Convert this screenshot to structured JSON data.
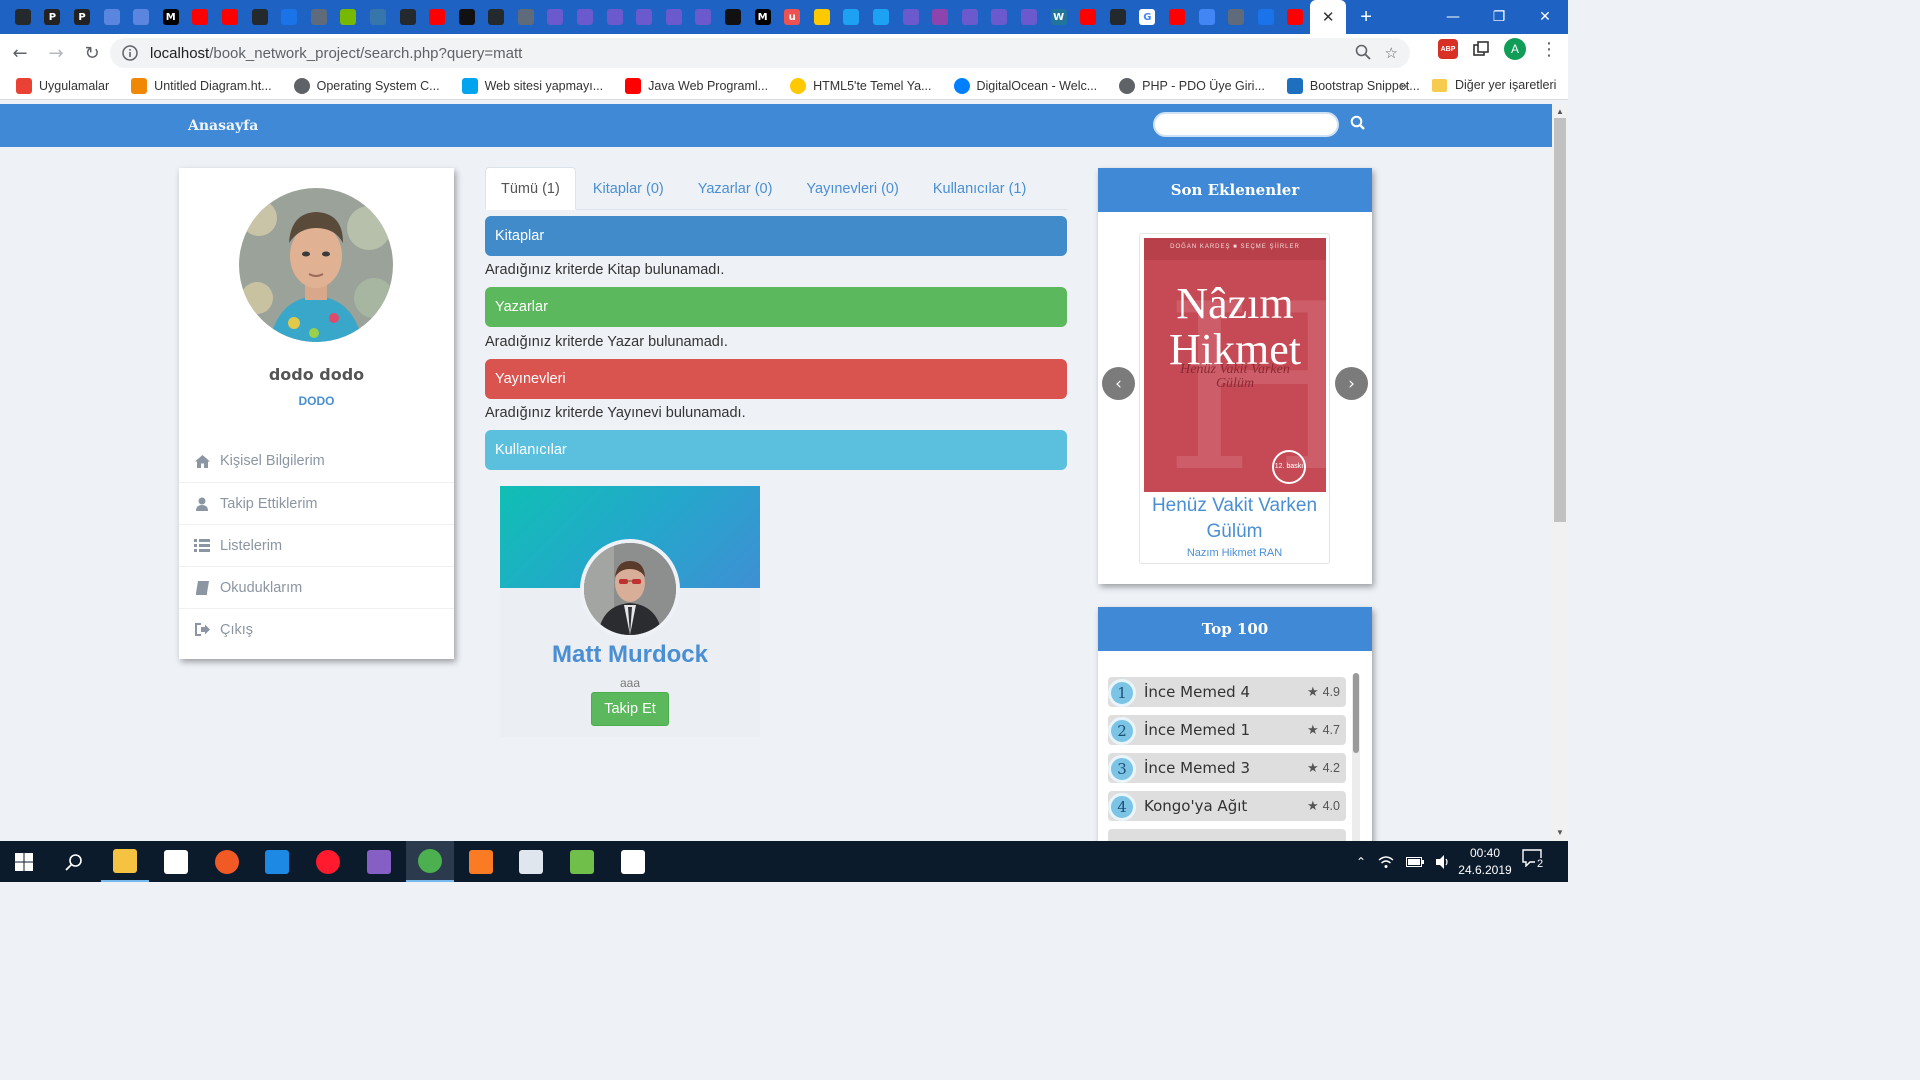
{
  "browser": {
    "tab_favicons": [
      {
        "icon": "github-icon",
        "color": "#24292e",
        "glyph": ""
      },
      {
        "icon": "p-letter-icon",
        "color": "#222222",
        "glyph": "P"
      },
      {
        "icon": "p-letter-icon",
        "color": "#222222",
        "glyph": "P"
      },
      {
        "icon": "arrows-icon",
        "color": "#5b86e0",
        "glyph": ""
      },
      {
        "icon": "arrows-icon",
        "color": "#5b86e0",
        "glyph": ""
      },
      {
        "icon": "medium-icon",
        "color": "#000000",
        "glyph": "M"
      },
      {
        "icon": "youtube-icon",
        "color": "#ff0000",
        "glyph": ""
      },
      {
        "icon": "youtube-icon",
        "color": "#ff0000",
        "glyph": ""
      },
      {
        "icon": "github-icon",
        "color": "#24292e",
        "glyph": ""
      },
      {
        "icon": "target-icon",
        "color": "#1a73e8",
        "glyph": ""
      },
      {
        "icon": "globe-icon",
        "color": "#5f6b7a",
        "glyph": ""
      },
      {
        "icon": "nvidia-icon",
        "color": "#76b900",
        "glyph": ""
      },
      {
        "icon": "python-icon",
        "color": "#3776ab",
        "glyph": ""
      },
      {
        "icon": "github-icon",
        "color": "#24292e",
        "glyph": ""
      },
      {
        "icon": "youtube-icon",
        "color": "#ff0000",
        "glyph": ""
      },
      {
        "icon": "image-icon",
        "color": "#111111",
        "glyph": ""
      },
      {
        "icon": "github-icon",
        "color": "#24292e",
        "glyph": ""
      },
      {
        "icon": "globe-icon",
        "color": "#5f6b7a",
        "glyph": ""
      },
      {
        "icon": "extension-icon",
        "color": "#6a5acd",
        "glyph": ""
      },
      {
        "icon": "extension-icon",
        "color": "#6a5acd",
        "glyph": ""
      },
      {
        "icon": "extension-icon",
        "color": "#6a5acd",
        "glyph": ""
      },
      {
        "icon": "extension-icon",
        "color": "#6a5acd",
        "glyph": ""
      },
      {
        "icon": "extension-icon",
        "color": "#6a5acd",
        "glyph": ""
      },
      {
        "icon": "extension-icon",
        "color": "#6a5acd",
        "glyph": ""
      },
      {
        "icon": "codepen-icon",
        "color": "#111111",
        "glyph": ""
      },
      {
        "icon": "medium-icon",
        "color": "#000000",
        "glyph": "M"
      },
      {
        "icon": "udemy-icon",
        "color": "#ec5252",
        "glyph": "u"
      },
      {
        "icon": "turkcell-icon",
        "color": "#ffc900",
        "glyph": ""
      },
      {
        "icon": "twitter-icon",
        "color": "#1da1f2",
        "glyph": ""
      },
      {
        "icon": "twitter-icon",
        "color": "#1da1f2",
        "glyph": ""
      },
      {
        "icon": "extension-icon",
        "color": "#6a5acd",
        "glyph": ""
      },
      {
        "icon": "atom-icon",
        "color": "#8e44ad",
        "glyph": ""
      },
      {
        "icon": "extension-icon",
        "color": "#6a5acd",
        "glyph": ""
      },
      {
        "icon": "extension-icon",
        "color": "#6a5acd",
        "glyph": ""
      },
      {
        "icon": "extension-icon",
        "color": "#6a5acd",
        "glyph": ""
      },
      {
        "icon": "wordpress-icon",
        "color": "#21759b",
        "glyph": "W"
      },
      {
        "icon": "youtube-icon",
        "color": "#ff0000",
        "glyph": ""
      },
      {
        "icon": "github-icon",
        "color": "#24292e",
        "glyph": ""
      },
      {
        "icon": "google-icon",
        "color": "#ffffff",
        "glyph": "G"
      },
      {
        "icon": "youtube-icon",
        "color": "#ff0000",
        "glyph": ""
      },
      {
        "icon": "translate-icon",
        "color": "#4285f4",
        "glyph": ""
      },
      {
        "icon": "globe-icon",
        "color": "#5f6b7a",
        "glyph": ""
      },
      {
        "icon": "history-icon",
        "color": "#1a73e8",
        "glyph": ""
      },
      {
        "icon": "youtube-icon",
        "color": "#ff0000",
        "glyph": ""
      }
    ],
    "url_host": "localhost",
    "url_path": "/book_network_project/search.php?query=matt",
    "profile_initial": "A",
    "abp_label": "ABP",
    "bookmarks": [
      {
        "label": "Uygulamalar",
        "icon": "apps-grid-icon",
        "color": "#e94235"
      },
      {
        "label": "Untitled Diagram.ht...",
        "icon": "drawio-icon",
        "color": "#f08705"
      },
      {
        "label": "Operating System C...",
        "icon": "globe-icon",
        "color": "#5f6368"
      },
      {
        "label": "Web sitesi yapmayı...",
        "icon": "microsoft-icon",
        "color": "#00a4ef"
      },
      {
        "label": "Java Web Programl...",
        "icon": "youtube-icon",
        "color": "#ff0000"
      },
      {
        "label": "HTML5'te Temel Ya...",
        "icon": "turkcell-icon",
        "color": "#ffc900"
      },
      {
        "label": "DigitalOcean - Welc...",
        "icon": "digitalocean-icon",
        "color": "#0080ff"
      },
      {
        "label": "PHP - PDO Üye Giri...",
        "icon": "globe-icon",
        "color": "#5f6368"
      },
      {
        "label": "Bootstrap Snippet...",
        "icon": "bootstrap-icon",
        "color": "#1f6fbf"
      }
    ],
    "bookmarks_more": "»",
    "other_bookmarks": "Diğer yer işaretleri"
  },
  "site": {
    "brand": "Anasayfa",
    "search_placeholder": "",
    "accent": "#4089d6"
  },
  "profile": {
    "name": "dodo dodo",
    "username": "DODO",
    "menu": [
      {
        "label": "Kişisel Bilgilerim",
        "icon": "home-icon"
      },
      {
        "label": "Takip Ettiklerim",
        "icon": "user-icon"
      },
      {
        "label": "Listelerim",
        "icon": "list-icon"
      },
      {
        "label": "Okuduklarım",
        "icon": "book-icon"
      },
      {
        "label": "Çıkış",
        "icon": "sign-out-icon"
      }
    ]
  },
  "search": {
    "tabs": [
      {
        "label": "Tümü (1)",
        "active": true
      },
      {
        "label": "Kitaplar (0)",
        "active": false
      },
      {
        "label": "Yazarlar (0)",
        "active": false
      },
      {
        "label": "Yayınevleri (0)",
        "active": false
      },
      {
        "label": "Kullanıcılar (1)",
        "active": false
      }
    ],
    "sections": [
      {
        "title": "Kitaplar",
        "color": "#428bca",
        "empty_text": "Aradığınız kriterde Kitap bulunamadı."
      },
      {
        "title": "Yazarlar",
        "color": "#5cb85c",
        "empty_text": "Aradığınız kriterde Yazar bulunamadı."
      },
      {
        "title": "Yayınevleri",
        "color": "#d9534f",
        "empty_text": "Aradığınız kriterde Yayınevi bulunamadı."
      },
      {
        "title": "Kullanıcılar",
        "color": "#5bc0de",
        "empty_text": ""
      }
    ],
    "user_result": {
      "name": "Matt Murdock",
      "username": "aaa",
      "follow_label": "Takip Et"
    }
  },
  "latest": {
    "title": "Son Eklenenler",
    "book_title": "Henüz Vakit Varken Gülüm",
    "book_author": "Nazım Hikmet RAN",
    "cover_series": "DOĞAN KARDEŞ ■ SEÇME ŞİİRLER",
    "cover_name_1": "Nâzım",
    "cover_name_2": "Hikmet",
    "cover_sub_1": "Henüz Vakit Varken",
    "cover_sub_2": "Gülüm",
    "cover_badge": "12. baskı",
    "prev_label": "‹",
    "next_label": "›"
  },
  "top100": {
    "title": "Top 100",
    "items": [
      {
        "rank": "1",
        "name": "İnce Memed 4",
        "rating": "4.9"
      },
      {
        "rank": "2",
        "name": "İnce Memed 1",
        "rating": "4.7"
      },
      {
        "rank": "3",
        "name": "İnce Memed 3",
        "rating": "4.2"
      },
      {
        "rank": "4",
        "name": "Kongo'ya Ağıt",
        "rating": "4.0"
      }
    ]
  },
  "taskbar": {
    "apps": [
      {
        "icon": "file-explorer-icon",
        "color": "#f5c242",
        "open": true,
        "active": false
      },
      {
        "icon": "store-icon",
        "color": "#ffffff",
        "open": false,
        "active": false
      },
      {
        "icon": "camera-icon",
        "color": "#f15a24",
        "open": false,
        "active": false
      },
      {
        "icon": "edge-icon",
        "color": "#1e88e5",
        "open": false,
        "active": false
      },
      {
        "icon": "opera-icon",
        "color": "#ff1b2d",
        "open": false,
        "active": false
      },
      {
        "icon": "visual-studio-icon",
        "color": "#865fc5",
        "open": false,
        "active": false
      },
      {
        "icon": "chrome-icon",
        "color": "#4caf50",
        "open": true,
        "active": true
      },
      {
        "icon": "xampp-icon",
        "color": "#fb7a24",
        "open": false,
        "active": false
      },
      {
        "icon": "settings-icon",
        "color": "#dfe6ee",
        "open": false,
        "active": false
      },
      {
        "icon": "paint-icon",
        "color": "#6fbf4a",
        "open": false,
        "active": false
      },
      {
        "icon": "photos-icon",
        "color": "#ffffff",
        "open": false,
        "active": false
      }
    ],
    "time": "00:40",
    "date": "24.6.2019",
    "notification_count": "2"
  }
}
